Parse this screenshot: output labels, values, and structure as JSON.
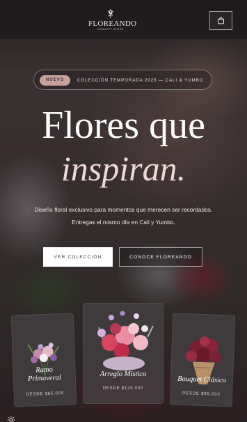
{
  "header": {
    "brand": "FLOREANDO",
    "brand_sub": "CONCEPT STORE",
    "cart_icon": "shopping-bag-icon"
  },
  "announcement": {
    "badge": "NUEVO",
    "text": "COLECCIÓN TEMPORADA 2025 — CALI & YUMBO"
  },
  "hero": {
    "title_line1": "Flores que",
    "title_line2": "inspiran.",
    "description_line1": "Diseño floral exclusivo para momentos que merecen ser recordados.",
    "description_line2": "Entregas el mismo día en Cali y Yumbo."
  },
  "cta": {
    "primary": "VER COLECCIÓN",
    "secondary": "CONOCE FLOREANDO"
  },
  "products": [
    {
      "name_line1": "Ramo",
      "name_line2": "Primaveral",
      "price": "DESDE $85.000"
    },
    {
      "name": "Arreglo Místico",
      "price": "DESDE $120.000"
    },
    {
      "name": "Bouquet Clásico",
      "price": "DESDE $95.000"
    }
  ],
  "colors": {
    "accent_badge": "#c9a09c",
    "italic_title": "#efd9d6",
    "header_bg": "#1e1a1c"
  },
  "footer": {
    "settings_icon": "gear-icon"
  }
}
